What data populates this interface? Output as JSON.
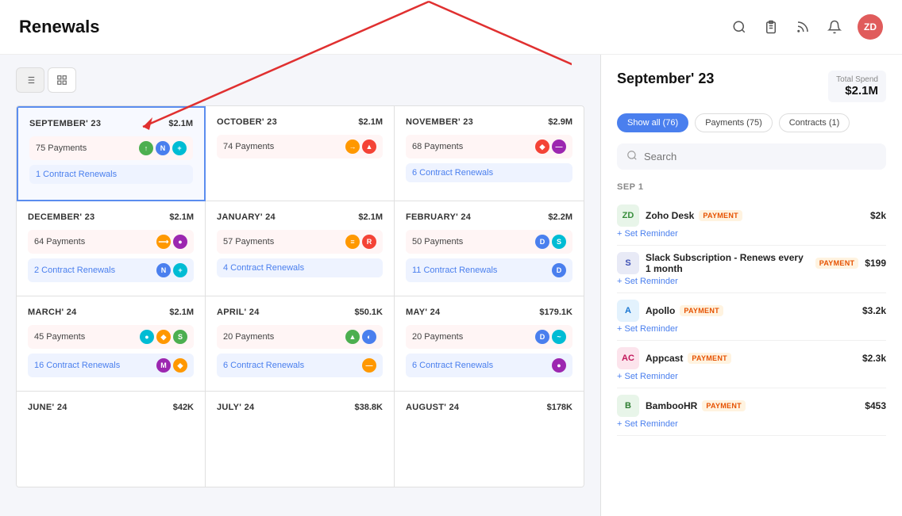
{
  "header": {
    "title": "Renewals",
    "user_initials": "ZD"
  },
  "view_toggle": {
    "list_label": "list",
    "grid_label": "grid"
  },
  "months": [
    {
      "id": "sep23",
      "name": "SEPTEMBER' 23",
      "amount": "$2.1M",
      "payments": "75 Payments",
      "contracts": "1 Contract Renewals",
      "selected": true
    },
    {
      "id": "oct23",
      "name": "OCTOBER' 23",
      "amount": "$2.1M",
      "payments": "74 Payments",
      "contracts": null
    },
    {
      "id": "nov23",
      "name": "NOVEMBER' 23",
      "amount": "$2.9M",
      "payments": "68 Payments",
      "contracts": "6 Contract Renewals"
    },
    {
      "id": "dec23",
      "name": "DECEMBER' 23",
      "amount": "$2.1M",
      "payments": "64 Payments",
      "contracts": "2 Contract Renewals"
    },
    {
      "id": "jan24",
      "name": "JANUARY' 24",
      "amount": "$2.1M",
      "payments": "57 Payments",
      "contracts": "4 Contract Renewals"
    },
    {
      "id": "feb24",
      "name": "FEBRUARY' 24",
      "amount": "$2.2M",
      "payments": "50 Payments",
      "contracts": "11 Contract Renewals"
    },
    {
      "id": "mar24",
      "name": "MARCH' 24",
      "amount": "$2.1M",
      "payments": "45 Payments",
      "contracts": "16 Contract Renewals"
    },
    {
      "id": "apr24",
      "name": "APRIL' 24",
      "amount": "$50.1K",
      "payments": "20 Payments",
      "contracts": "6 Contract Renewals"
    },
    {
      "id": "may24",
      "name": "MAY' 24",
      "amount": "$179.1K",
      "payments": "20 Payments",
      "contracts": "6 Contract Renewals"
    },
    {
      "id": "jun24",
      "name": "JUNE' 24",
      "amount": "$42K",
      "payments": null,
      "contracts": null
    },
    {
      "id": "jul24",
      "name": "JULY' 24",
      "amount": "$38.8K",
      "payments": null,
      "contracts": null
    },
    {
      "id": "aug24",
      "name": "AUGUST' 24",
      "amount": "$178K",
      "payments": null,
      "contracts": null
    }
  ],
  "right_panel": {
    "title": "September' 23",
    "total_spend_label": "Total Spend",
    "total_spend_value": "$2.1M",
    "filters": [
      {
        "label": "Show all (76)",
        "active": true
      },
      {
        "label": "Payments (75)",
        "active": false
      },
      {
        "label": "Contracts (1)",
        "active": false
      }
    ],
    "search_placeholder": "Search",
    "date_group": "SEP 1",
    "items": [
      {
        "id": "zoho",
        "name": "Zoho Desk",
        "badge": "PAYMENT",
        "amount": "$2k",
        "reminder": "+ Set Reminder",
        "logo_text": "ZD",
        "logo_class": "logo-zoho"
      },
      {
        "id": "slack",
        "name": "Slack Subscription - Renews every 1 month",
        "badge": "PAYMENT",
        "amount": "$199",
        "reminder": "+ Set Reminder",
        "logo_text": "S",
        "logo_class": "logo-slack"
      },
      {
        "id": "apollo",
        "name": "Apollo",
        "badge": "PAYMENT",
        "amount": "$3.2k",
        "reminder": "+ Set Reminder",
        "logo_text": "A",
        "logo_class": "logo-apollo"
      },
      {
        "id": "appcast",
        "name": "Appcast",
        "badge": "PAYMENT",
        "amount": "$2.3k",
        "reminder": "+ Set Reminder",
        "logo_text": "AC",
        "logo_class": "logo-appcast"
      },
      {
        "id": "bamboo",
        "name": "BambooHR",
        "badge": "PAYMENT",
        "amount": "$453",
        "reminder": "+ Set Reminder",
        "logo_text": "B",
        "logo_class": "logo-bamboo"
      }
    ]
  }
}
